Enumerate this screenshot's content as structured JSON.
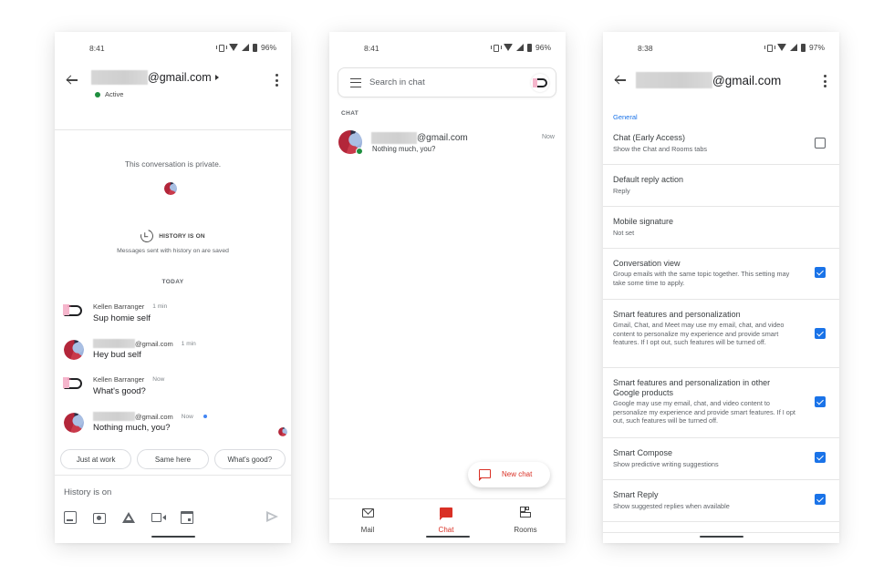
{
  "phone1": {
    "status": {
      "time": "8:41",
      "battery": "96%"
    },
    "header": {
      "email_suffix": "@gmail.com",
      "presence": "Active"
    },
    "private_notice": "This conversation is private.",
    "history": {
      "title": "HISTORY IS ON",
      "subtitle": "Messages sent with history on are saved"
    },
    "date_divider": "TODAY",
    "messages": [
      {
        "sender": "Kellen Barranger",
        "sender_type": "bot-avatar",
        "time": "1 min",
        "text": "Sup homie self"
      },
      {
        "sender": "@gmail.com",
        "sender_type": "person-avatar",
        "time": "1 min",
        "text": "Hey bud self"
      },
      {
        "sender": "Kellen Barranger",
        "sender_type": "bot-avatar",
        "time": "Now",
        "text": "What's good?"
      },
      {
        "sender": "@gmail.com",
        "sender_type": "person-avatar",
        "time": "Now",
        "text": "Nothing much, you?"
      }
    ],
    "smart_replies": [
      "Just at work",
      "Same here",
      "What's good?"
    ],
    "compose": {
      "placeholder": "History is on"
    },
    "tools": [
      "image-icon",
      "camera-icon",
      "drive-icon",
      "video-icon",
      "calendar-icon"
    ]
  },
  "phone2": {
    "status": {
      "time": "8:41",
      "battery": "96%"
    },
    "search": {
      "placeholder": "Search in chat"
    },
    "section_label": "CHAT",
    "conversations": [
      {
        "name_suffix": "@gmail.com",
        "preview": "Nothing much, you?",
        "time": "Now",
        "online": true
      }
    ],
    "fab": {
      "label": "New chat"
    },
    "nav": [
      {
        "label": "Mail",
        "icon": "mail-icon",
        "active": false
      },
      {
        "label": "Chat",
        "icon": "chat-icon",
        "active": true
      },
      {
        "label": "Rooms",
        "icon": "rooms-icon",
        "active": false
      }
    ],
    "colors": {
      "accent": "#d93025"
    }
  },
  "phone3": {
    "status": {
      "time": "8:38",
      "battery": "97%"
    },
    "header": {
      "email_suffix": "@gmail.com"
    },
    "section": "General",
    "settings": [
      {
        "title": "Chat (Early Access)",
        "desc": "Show the Chat and Rooms tabs",
        "checkbox": false
      },
      {
        "title": "Default reply action",
        "desc": "Reply"
      },
      {
        "title": "Mobile signature",
        "desc": "Not set"
      },
      {
        "title": "Conversation view",
        "desc": "Group emails with the same topic together. This setting may take some time to apply.",
        "checkbox": true
      },
      {
        "title": "Smart features and personalization",
        "desc": "Gmail, Chat, and Meet may use my email, chat, and video content to personalize my experience and provide smart features. If I opt out, such features will be turned off.",
        "checkbox": true
      },
      {
        "title": "Smart features and personalization in other Google products",
        "desc": "Google may use my email, chat, and video content to personalize my experience and provide smart features. If I opt out, such features will be turned off.",
        "checkbox": true
      },
      {
        "title": "Smart Compose",
        "desc": "Show predictive writing suggestions",
        "checkbox": true
      },
      {
        "title": "Smart Reply",
        "desc": "Show suggested replies when available",
        "checkbox": true
      }
    ],
    "colors": {
      "accent": "#1a73e8"
    }
  }
}
